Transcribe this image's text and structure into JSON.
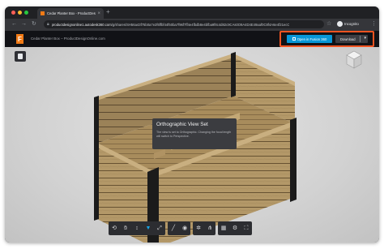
{
  "browser": {
    "tab_title": "Cedar Planter Box - ProductDesignOnline.com",
    "tab_close": "×",
    "new_tab": "+",
    "nav_back": "←",
    "nav_forward": "→",
    "nav_reload": "↻",
    "url_host": "productdesignonline1.autodesk360.com",
    "url_path": "/g/shares/SH56a43f75b0a7e2f6ffbf44f50ba7f96f7ff4e4fbdb8e4bfba9f8c4d82c9CAs0O9A4D4E49aaf0C8f4A6e4f21ecC",
    "bookmark_star": "☆",
    "profile_label": "Incognito",
    "menu": "⋮"
  },
  "app": {
    "logo_letter": "F",
    "doc_title": "Cedar Planter Box – ProductDesignOnline.com",
    "open_button": "Open in Fusion 360",
    "download_button": "Download",
    "download_chevron": "▾"
  },
  "tooltip": {
    "title": "Orthographic View Set",
    "body": "The view is set to Orthographic. Changing the focal length will switch to Perspective."
  },
  "toolbar": {
    "groups": [
      [
        "orbit-icon",
        "pan-icon",
        "zoom-icon",
        "first-person-icon",
        "camera-icon"
      ],
      [
        "measure-icon",
        "section-icon"
      ],
      [
        "explode-icon",
        "model-browser-icon"
      ],
      [
        "settings-icon",
        "properties-icon",
        "fullscreen-icon"
      ]
    ]
  },
  "colors": {
    "accent": "#0696d7",
    "highlight": "#f05320",
    "brand": "#f07a16",
    "wood": "#b59a6c"
  }
}
